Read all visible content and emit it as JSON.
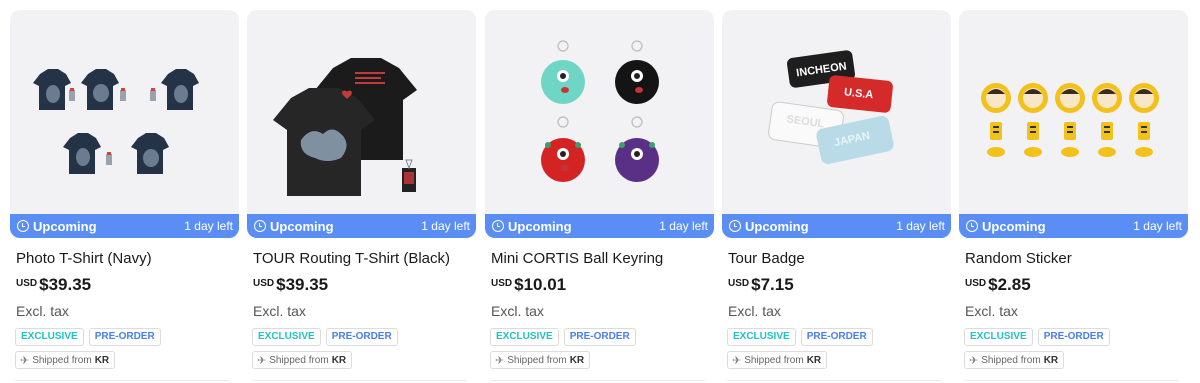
{
  "products": [
    {
      "title": "Photo T-Shirt (Navy)",
      "currency": "USD",
      "price": "$39.35",
      "tax": "Excl. tax",
      "status": "Upcoming",
      "time_left": "1 day left",
      "tags": [
        "EXCLUSIVE",
        "PRE-ORDER"
      ],
      "ship_prefix": "Shipped from",
      "ship_country": "KR"
    },
    {
      "title": "TOUR Routing T-Shirt (Black)",
      "currency": "USD",
      "price": "$39.35",
      "tax": "Excl. tax",
      "status": "Upcoming",
      "time_left": "1 day left",
      "tags": [
        "EXCLUSIVE",
        "PRE-ORDER"
      ],
      "ship_prefix": "Shipped from",
      "ship_country": "KR"
    },
    {
      "title": "Mini CORTIS Ball Keyring",
      "currency": "USD",
      "price": "$10.01",
      "tax": "Excl. tax",
      "status": "Upcoming",
      "time_left": "1 day left",
      "tags": [
        "EXCLUSIVE",
        "PRE-ORDER"
      ],
      "ship_prefix": "Shipped from",
      "ship_country": "KR"
    },
    {
      "title": "Tour Badge",
      "currency": "USD",
      "price": "$7.15",
      "tax": "Excl. tax",
      "status": "Upcoming",
      "time_left": "1 day left",
      "tags": [
        "EXCLUSIVE",
        "PRE-ORDER"
      ],
      "ship_prefix": "Shipped from",
      "ship_country": "KR",
      "image_text": {
        "badge_1": "INCHEON",
        "badge_1_sub": "PUT YOUR PHONE DOWN",
        "badge_2": "U.S.A",
        "badge_2_sub": "PUT YOUR PHONE DOWN",
        "badge_3": "SEOUL",
        "badge_4": "JAPAN"
      }
    },
    {
      "title": "Random Sticker",
      "currency": "USD",
      "price": "$2.85",
      "tax": "Excl. tax",
      "status": "Upcoming",
      "time_left": "1 day left",
      "tags": [
        "EXCLUSIVE",
        "PRE-ORDER"
      ],
      "ship_prefix": "Shipped from",
      "ship_country": "KR"
    }
  ],
  "icons": {
    "status": "clock-icon",
    "shipping": "airplane-icon"
  },
  "colors": {
    "status_bar": "#5b8ef5",
    "tag_exclusive": "#1fc2c6",
    "tag_preorder": "#4a7fe8",
    "thumb_bg": "#f2f2f4"
  }
}
